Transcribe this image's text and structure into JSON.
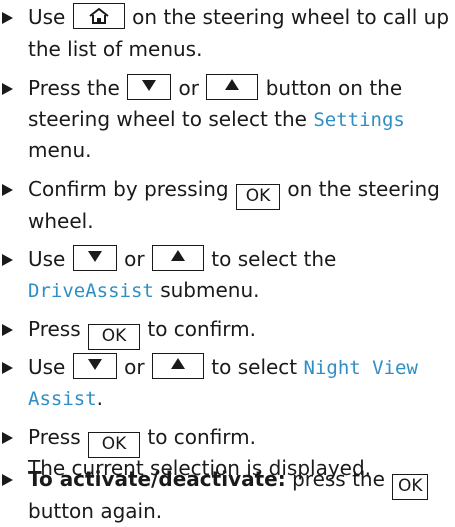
{
  "steps": [
    {
      "lines": [
        {
          "pre": "Use",
          "key_after_pre": "home",
          "post": "on the steering wheel to call up"
        },
        {
          "text": "the list of menus."
        }
      ]
    },
    {
      "lines": [
        {
          "pre": "Press the",
          "k1": "down",
          "mid": "or",
          "k2": "up",
          "post": "button on the"
        },
        {
          "text": "steering wheel to select the",
          "menu": "Settings"
        },
        {
          "text": "menu."
        }
      ]
    },
    {
      "lines": [
        {
          "pre": "Confirm by pressing",
          "ok": "OK",
          "post": "on the steering"
        },
        {
          "text": "wheel."
        }
      ]
    },
    {
      "lines": [
        {
          "pre": "Use",
          "k1": "down",
          "mid": "or",
          "k2": "up",
          "post": "to select the"
        },
        {
          "menu": "DriveAssist",
          "text": "submenu."
        }
      ]
    },
    {
      "lines": [
        {
          "pre": "Press",
          "ok": "OK",
          "post": "to confirm."
        }
      ]
    },
    {
      "lines": [
        {
          "pre": "Use",
          "k1": "down",
          "mid": "or",
          "k2": "up",
          "post": "to select",
          "menu": "Night View"
        },
        {
          "menu": "Assist",
          "text": "."
        }
      ]
    },
    {
      "lines": [
        {
          "pre": "Press",
          "ok": "OK",
          "post": "to confirm."
        },
        {
          "text": "The current selection is displayed."
        }
      ]
    },
    {
      "lines": [
        {
          "bold": "To activate/deactivate:",
          "pre": "press the",
          "ok": "OK"
        },
        {
          "text": "button again."
        }
      ]
    }
  ],
  "icons": {
    "bullet": "triangle-right-icon",
    "home": "home-icon",
    "down": "down-arrow-icon",
    "up": "up-arrow-icon"
  },
  "colors": {
    "menu_text": "#2f8fc5",
    "body_text": "#1a1a1a"
  }
}
